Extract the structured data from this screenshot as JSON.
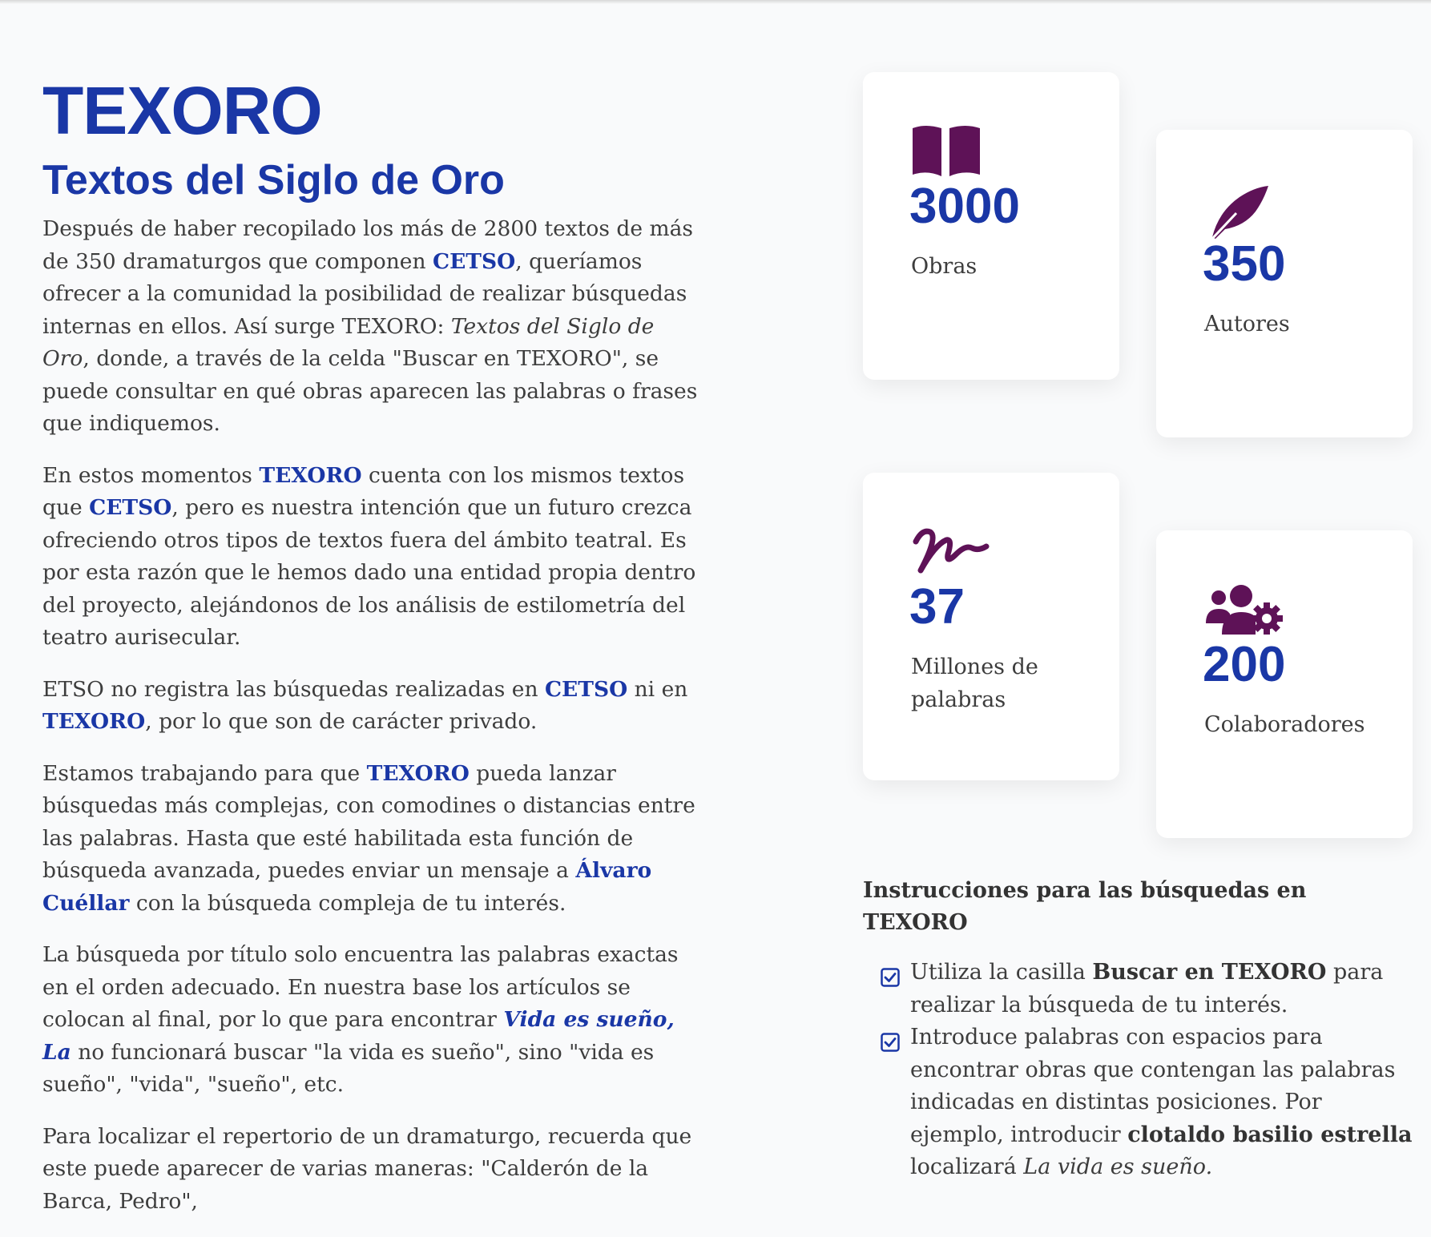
{
  "header": {
    "title": "TEXORO",
    "subtitle": "Textos del Siglo de Oro"
  },
  "paragraphs": {
    "p1": {
      "t1": "Después de haber recopilado los más de 2800 textos de más de 350 dramaturgos que componen ",
      "link1": "CETSO",
      "t2": ", queríamos ofrecer a la comunidad la posibilidad de realizar búsquedas internas en ellos. Así surge TEXORO: ",
      "em1": "Textos del Siglo de Oro",
      "t3": ", donde, a través de la celda \"Buscar en TEXORO\", se puede consultar en qué obras aparecen las palabras o frases que indiquemos."
    },
    "p2": {
      "t1": "En estos momentos ",
      "link1": "TEXORO",
      "t2": " cuenta con los mismos textos que ",
      "link2": "CETSO",
      "t3": ", pero es nuestra intención que un futuro crezca ofreciendo otros tipos de textos fuera del ámbito teatral. Es por esta razón que le hemos dado una entidad propia dentro del proyecto, alejándonos de los análisis de estilometría del teatro aurisecular."
    },
    "p3": {
      "t1": "ETSO no registra las búsquedas realizadas en ",
      "link1": "CETSO",
      "t2": " ni en ",
      "link2": "TEXORO",
      "t3": ", por lo que son de carácter privado."
    },
    "p4": {
      "t1": "Estamos trabajando para que ",
      "link1": "TEXORO",
      "t2": " pueda lanzar búsquedas más complejas, con comodines o distancias entre las palabras. Hasta que esté habilitada esta función de búsqueda avanzada, puedes enviar un mensaje a ",
      "link2": "Álvaro Cuéllar",
      "t3": " con la búsqueda compleja de tu interés."
    },
    "p5": {
      "t1": "La búsqueda por título solo encuentra las palabras exactas en el orden adecuado. En nuestra base los artículos se colocan al final, por lo que para encontrar ",
      "link1": "Vida es sueño, La",
      "t2": " no funcionará buscar \"la vida es sueño\", sino \"vida es sueño\", \"vida\", \"sueño\", etc."
    },
    "p6": {
      "t1": "Para localizar el repertorio de un dramaturgo, recuerda que este puede aparecer de varias maneras: \"Calderón de la Barca, Pedro\","
    }
  },
  "stats": [
    {
      "icon": "book-icon",
      "value": "3000",
      "label": "Obras"
    },
    {
      "icon": "feather-icon",
      "value": "350",
      "label": "Autores"
    },
    {
      "icon": "signature-icon",
      "value": "37",
      "label": "Millones de palabras"
    },
    {
      "icon": "users-gear-icon",
      "value": "200",
      "label": "Colaboradores"
    }
  ],
  "instructions": {
    "title": "Instrucciones para las búsquedas en TEXORO",
    "items": [
      {
        "t1": "Utiliza la casilla ",
        "b1": "Buscar en TEXORO",
        "t2": " para realizar la búsqueda de tu interés."
      },
      {
        "t1": "Introduce palabras con espacios para encontrar obras que contengan las palabras indicadas en distintas posiciones. Por ejemplo, introducir ",
        "b1": "clotaldo basilio estrella",
        "t2": " localizará ",
        "em1": "La vida es sueño."
      }
    ]
  },
  "colors": {
    "accent": "#1a37a6",
    "icon": "#5e1257",
    "text": "#3d3d3d"
  }
}
